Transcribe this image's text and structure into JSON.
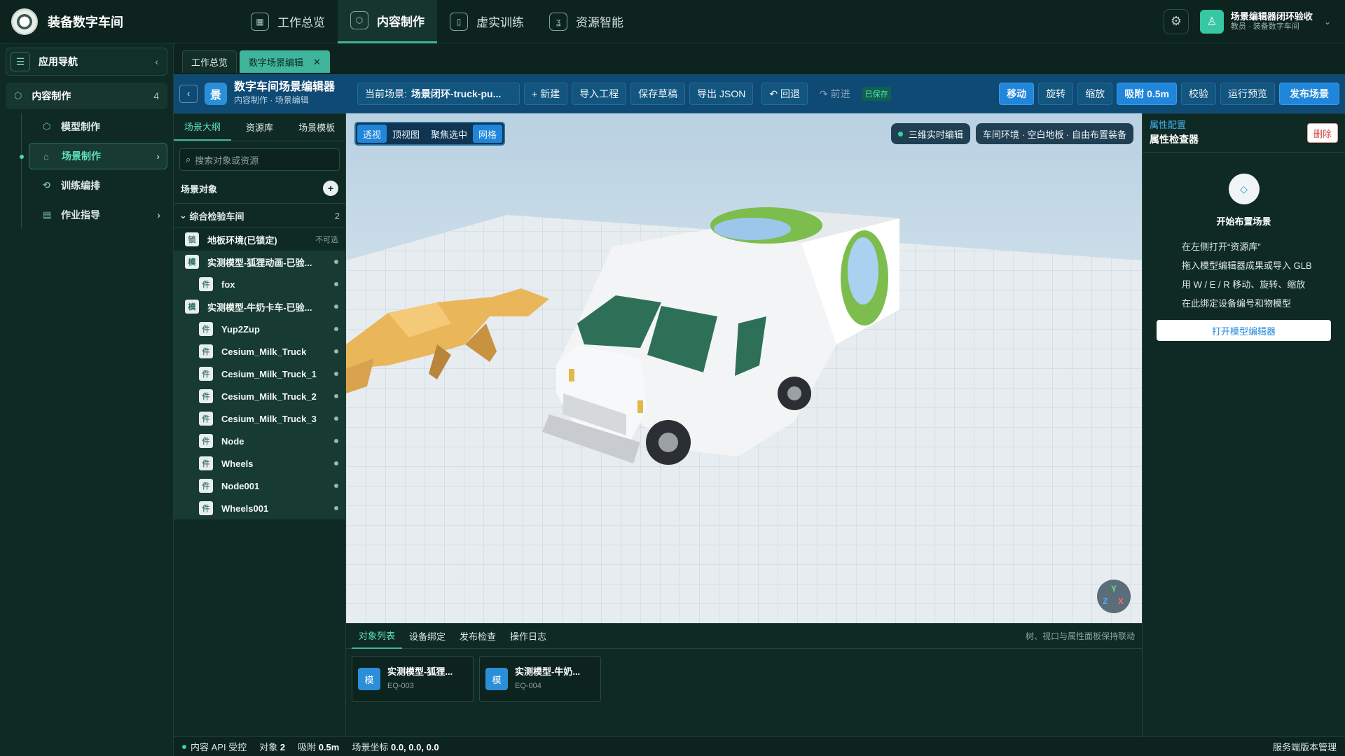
{
  "app": {
    "title": "装备数字车间"
  },
  "topnav": [
    {
      "label": "工作总览",
      "icon": "grid-icon"
    },
    {
      "label": "内容制作",
      "icon": "cube-icon"
    },
    {
      "label": "虚实训练",
      "icon": "book-icon"
    },
    {
      "label": "资源智能",
      "icon": "ai-icon"
    }
  ],
  "user": {
    "name": "场景编辑器闭环验收",
    "role": "教员 · 装备数字车间"
  },
  "leftnav": {
    "title": "应用导航",
    "section": {
      "label": "内容制作",
      "count": "4"
    },
    "items": [
      {
        "label": "模型制作"
      },
      {
        "label": "场景制作"
      },
      {
        "label": "训练编排"
      },
      {
        "label": "作业指导"
      }
    ]
  },
  "tabs": [
    {
      "label": "工作总览"
    },
    {
      "label": "数字场景编辑"
    }
  ],
  "editor": {
    "icon_text": "景",
    "title": "数字车间场景编辑器",
    "subtitle": "内容制作 · 场景编辑",
    "scene_label": "当前场景:",
    "scene_value": "场景闭环-truck-pu...",
    "new": "+ 新建",
    "import": "导入工程",
    "save": "保存草稿",
    "export": "导出 JSON",
    "undo": "↶ 回退",
    "redo": "↷ 前进",
    "saved": "已保存",
    "move": "移动",
    "rotate": "旋转",
    "scale": "缩放",
    "snap": "吸附 0.5m",
    "validate": "校验",
    "preview": "运行预览",
    "publish": "发布场景"
  },
  "outline": {
    "tabs": [
      "场景大纲",
      "资源库",
      "场景模板"
    ],
    "search_placeholder": "搜索对象或资源",
    "objects_title": "场景对象",
    "group": {
      "label": "综合检验车间",
      "count": "2"
    },
    "floor": {
      "badge": "锁",
      "label": "地板环境(已锁定)",
      "tag": "不可选"
    },
    "model1": {
      "badge": "模",
      "label": "实测模型-狐狸动画-已验..."
    },
    "model1_children": [
      {
        "badge": "件",
        "label": "fox"
      }
    ],
    "model2": {
      "badge": "模",
      "label": "实测模型-牛奶卡车-已验..."
    },
    "model2_children": [
      {
        "badge": "件",
        "label": "Yup2Zup"
      },
      {
        "badge": "件",
        "label": "Cesium_Milk_Truck"
      },
      {
        "badge": "件",
        "label": "Cesium_Milk_Truck_1"
      },
      {
        "badge": "件",
        "label": "Cesium_Milk_Truck_2"
      },
      {
        "badge": "件",
        "label": "Cesium_Milk_Truck_3"
      },
      {
        "badge": "件",
        "label": "Node"
      },
      {
        "badge": "件",
        "label": "Wheels"
      },
      {
        "badge": "件",
        "label": "Node001"
      },
      {
        "badge": "件",
        "label": "Wheels001"
      }
    ]
  },
  "viewport": {
    "modes": [
      "透视",
      "顶视图",
      "聚焦选中",
      "网格"
    ],
    "live": "三维实时编辑",
    "env": "车间环境 · 空白地板 · 自由布置装备",
    "gizmo": {
      "y": "Y",
      "z": "Z",
      "x": "X"
    }
  },
  "bottom": {
    "tabs": [
      "对象列表",
      "设备绑定",
      "发布检查",
      "操作日志"
    ],
    "hint": "树、视口与属性面板保持联动",
    "cards": [
      {
        "badge": "模",
        "name": "实测模型-狐狸...",
        "code": "EQ-003"
      },
      {
        "badge": "模",
        "name": "实测模型-牛奶...",
        "code": "EQ-004"
      }
    ]
  },
  "inspector": {
    "category": "属性配置",
    "title": "属性检查器",
    "delete": "删除",
    "empty_icon": "◇",
    "empty_title": "开始布置场景",
    "steps": [
      "在左侧打开“资源库”",
      "拖入模型编辑器成果或导入 GLB",
      "用 W / E / R 移动、旋转、缩放",
      "在此绑定设备编号和物模型"
    ],
    "button": "打开模型编辑器"
  },
  "status": {
    "api": "内容 API 受控",
    "objects_label": "对象",
    "objects_value": "2",
    "snap_label": "吸附",
    "snap_value": "0.5m",
    "coord_label": "场景坐标",
    "coord_value": "0.0, 0.0, 0.0",
    "right": "服务端版本管理"
  },
  "colors": {
    "accent": "#3fb59b",
    "toolbar": "#0f4a74",
    "primary": "#1f86db",
    "bg": "#0f2a24"
  }
}
